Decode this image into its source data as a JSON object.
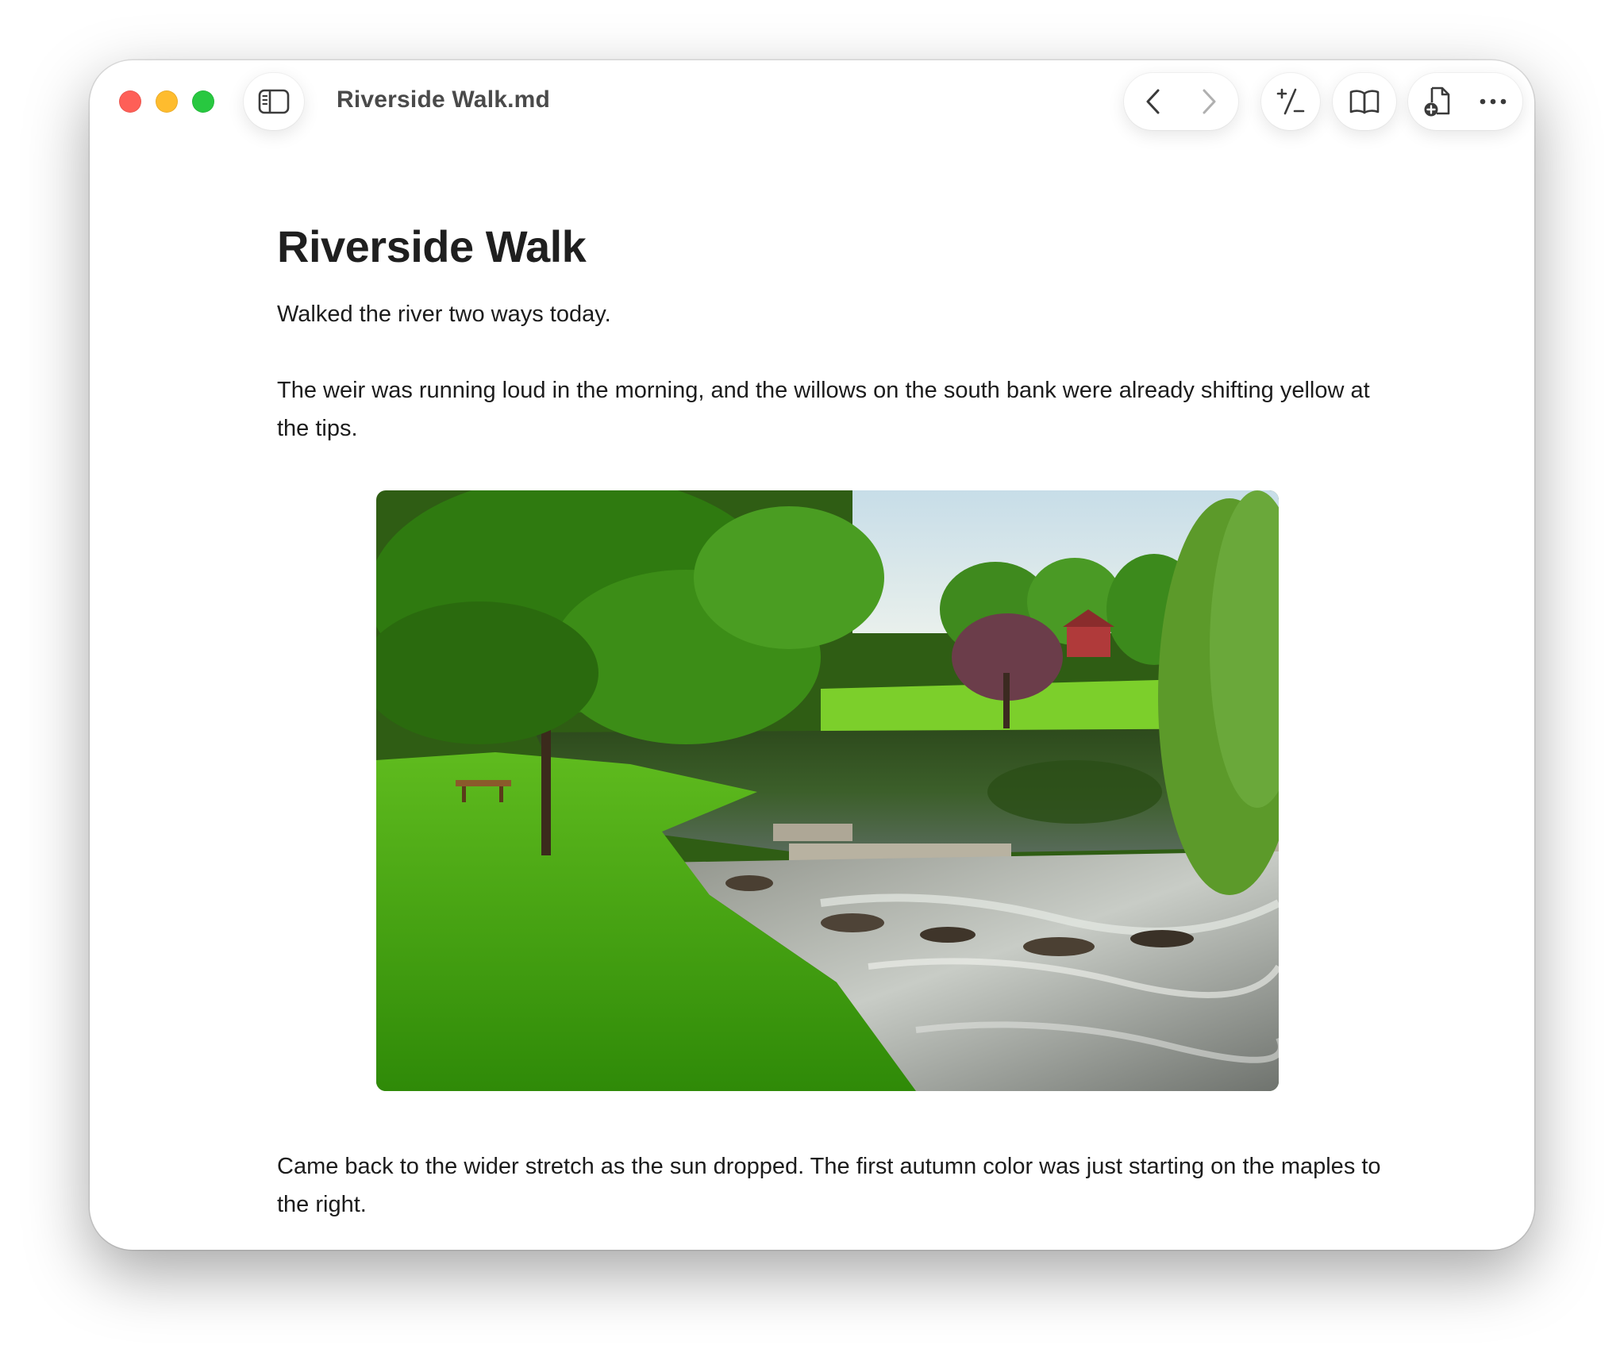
{
  "window": {
    "file_name": "Riverside Walk.md"
  },
  "toolbar": {
    "sidebar_icon": "sidebar-toggle-icon",
    "back_icon": "chevron-left-icon",
    "forward_icon": "chevron-right-icon",
    "diff_icon": "plus-minus-icon",
    "reader_icon": "book-icon",
    "new_doc_icon": "new-document-icon",
    "more_icon": "ellipsis-icon"
  },
  "document": {
    "title": "Riverside Walk",
    "paragraphs": [
      "Walked the river two ways today.",
      "The weir was running loud in the morning, and the willows on the south bank were already shifting yellow at the tips.",
      "Came back to the wider stretch as the sun dropped. The first autumn color was just starting on the maples to the right."
    ]
  },
  "colors": {
    "close": "#fe5f57",
    "minimize": "#febc2e",
    "zoom": "#28c840"
  }
}
